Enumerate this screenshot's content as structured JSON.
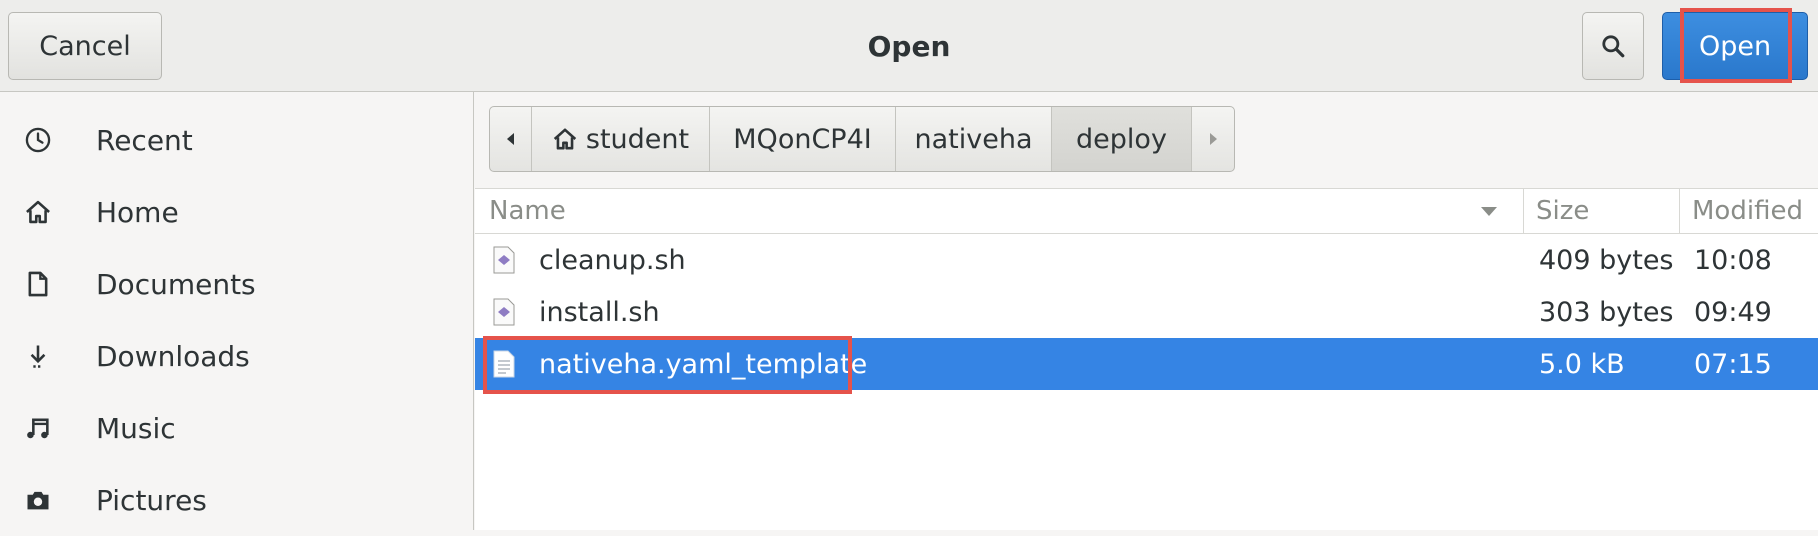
{
  "header": {
    "title": "Open",
    "cancel_label": "Cancel",
    "open_label": "Open",
    "search_icon": "search-icon"
  },
  "sidebar": {
    "items": [
      {
        "label": "Recent",
        "icon": "clock-icon"
      },
      {
        "label": "Home",
        "icon": "home-icon"
      },
      {
        "label": "Documents",
        "icon": "document-icon"
      },
      {
        "label": "Downloads",
        "icon": "download-icon"
      },
      {
        "label": "Music",
        "icon": "music-icon"
      },
      {
        "label": "Pictures",
        "icon": "camera-icon"
      }
    ]
  },
  "pathbar": {
    "segments": [
      "student",
      "MQonCP4I",
      "nativeha",
      "deploy"
    ],
    "active": "deploy"
  },
  "columns": {
    "name": "Name",
    "size": "Size",
    "modified": "Modified"
  },
  "files": [
    {
      "name": "cleanup.sh",
      "size": "409 bytes",
      "modified": "10:08",
      "type": "script"
    },
    {
      "name": "install.sh",
      "size": "303 bytes",
      "modified": "09:49",
      "type": "script"
    },
    {
      "name": "nativeha.yaml_template",
      "size": "5.0 kB",
      "modified": "07:15",
      "type": "text",
      "selected": true
    }
  ],
  "colors": {
    "accent": "#3584e4",
    "highlight": "#e5534b"
  }
}
